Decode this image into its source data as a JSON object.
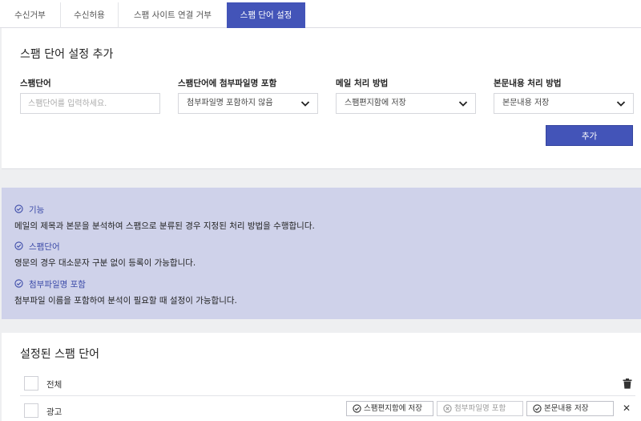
{
  "tabs": [
    {
      "label": "수신거부"
    },
    {
      "label": "수신허용"
    },
    {
      "label": "스팸 사이트 연결 거부"
    },
    {
      "label": "스팸 단어 설정"
    }
  ],
  "add_panel": {
    "title": "스팸 단어 설정 추가",
    "word_label": "스팸단어",
    "word_placeholder": "스팸단어를 입력하세요.",
    "attach_label": "스팸단어에 첨부파일명 포함",
    "attach_value": "첨부파일명 포함하지 않음",
    "mail_label": "메일 처리 방법",
    "mail_value": "스팸편지함에 저장",
    "body_label": "본문내용 처리 방법",
    "body_value": "본문내용 저장",
    "add_button": "추가"
  },
  "info": {
    "items": [
      {
        "heading": "기능",
        "text": "메일의 제목과 본문을 분석하여 스팸으로 분류된 경우 지정된 처리 방법을 수행합니다."
      },
      {
        "heading": "스팸단어",
        "text": "영문의 경우 대소문자 구분 없이 등록이 가능합니다."
      },
      {
        "heading": "첨부파일명 포함",
        "text": "첨부파일 이름을 포함하여 분석이 필요할 때 설정이 가능합니다."
      }
    ]
  },
  "list": {
    "title": "설정된 스팸 단어",
    "all_label": "전체",
    "rows": [
      {
        "word": "광고",
        "mail_action": "스팸편지함에 저장",
        "attach_action": "첨부파일명 포함",
        "body_action": "본문내용 저장"
      }
    ]
  },
  "colors": {
    "accent": "#4354b8",
    "info_bg": "#cfd2ea"
  }
}
